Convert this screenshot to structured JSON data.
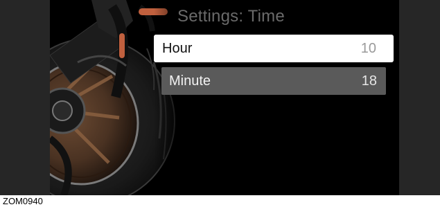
{
  "screen": {
    "title": "Settings: Time",
    "items": [
      {
        "label": "Hour",
        "value": "10",
        "state": "selected"
      },
      {
        "label": "Minute",
        "value": "18",
        "state": "normal"
      }
    ]
  },
  "figure_code": "ZOM0940",
  "colors": {
    "background": "#000000",
    "bezel": "#262626",
    "title": "#6a6a6a",
    "selected_row": "#ffffff",
    "normal_row": "#5a5a5a",
    "accent_copper": "#c0603e"
  },
  "icons": {
    "background_image": "motorcycle-rear-wheel-graphic"
  }
}
